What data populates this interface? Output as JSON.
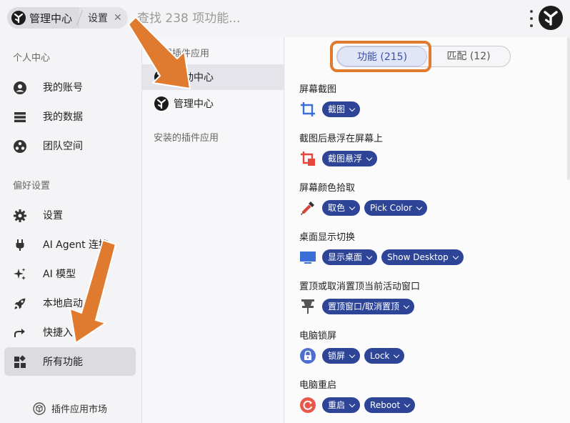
{
  "topbar": {
    "crumb_main": "管理中心",
    "crumb_sub": "设置",
    "crumb_close": "✕",
    "search_placeholder": "查找 238 项功能..."
  },
  "sidebar": {
    "section_personal": "个人中心",
    "section_prefs": "偏好设置",
    "items": [
      {
        "label": "我的账号",
        "icon": "user-icon"
      },
      {
        "label": "我的数据",
        "icon": "database-icon"
      },
      {
        "label": "团队空间",
        "icon": "team-icon"
      },
      {
        "label": "设置",
        "icon": "gear-icon"
      },
      {
        "label": "AI Agent 连接",
        "icon": "plug-icon"
      },
      {
        "label": "AI 模型",
        "icon": "sparkle-icon"
      },
      {
        "label": "本地启动",
        "icon": "rocket-icon"
      },
      {
        "label": "快捷入",
        "icon": "share-icon"
      },
      {
        "label": "所有功能",
        "icon": "widgets-icon"
      }
    ],
    "market_label": "插件应用市场"
  },
  "midcol": {
    "section_builtin": "内置插件应用",
    "section_installed": "安装的插件应用",
    "items": [
      {
        "label": "启动中心"
      },
      {
        "label": "管理中心"
      }
    ]
  },
  "tabs": {
    "features": "功能 (215)",
    "matches": "匹配 (12)"
  },
  "features": [
    {
      "title": "屏幕截图",
      "icon": "crop-icon",
      "chips": [
        "截图"
      ]
    },
    {
      "title": "截图后悬浮在屏幕上",
      "icon": "crop-float-icon",
      "chips": [
        "截图悬浮"
      ]
    },
    {
      "title": "屏幕颜色拾取",
      "icon": "eyedropper-icon",
      "chips": [
        "取色",
        "Pick Color"
      ]
    },
    {
      "title": "桌面显示切换",
      "icon": "monitor-icon",
      "chips": [
        "显示桌面",
        "Show Desktop"
      ]
    },
    {
      "title": "置顶或取消置顶当前活动窗口",
      "icon": "pin-icon",
      "chips": [
        "置顶窗口/取消置顶"
      ]
    },
    {
      "title": "电脑锁屏",
      "icon": "lock-icon",
      "chips": [
        "锁屏",
        "Lock"
      ]
    },
    {
      "title": "电脑重启",
      "icon": "restart-icon",
      "chips": [
        "重启",
        "Reboot"
      ]
    }
  ],
  "colors": {
    "chip": "#2e4597",
    "highlight": "#e07a2e",
    "accent_tab": "#3c50a8"
  }
}
